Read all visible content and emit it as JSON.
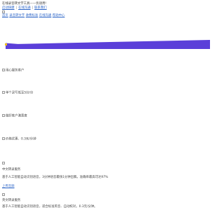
{
  "header": {
    "tagline": "在线录音转文字工具——优语用!",
    "links": [
      "启动快捷",
      "在线沟通",
      "联系我们"
    ],
    "logo_alt": "logo"
  },
  "nav": {
    "items": [
      "首页",
      "录音转文字",
      "收费标准",
      "在线沟通",
      "帮助中心"
    ]
  },
  "features": [
    "用心服务客户",
    "单个录写低至5分/分",
    "做好客户满意度",
    "价格优惠、0.3元/分钟"
  ],
  "services": {
    "transcription": {
      "title": "中文转录服务",
      "description": "基于人工智能自动识别语音，3分钟语音最快1分钟出稿，准确率最高可达97%",
      "upload_label": "上传音频"
    },
    "proofreading": {
      "title": "英文转录服务",
      "description": "基于人工智能自动识别语音，适合标准英音、自动校对，0.3元/分钟。"
    }
  },
  "colors": {
    "banner_purple": "#5b3fd9",
    "banner_yellow": "#f4c21b",
    "link_blue": "#2f67c8"
  }
}
